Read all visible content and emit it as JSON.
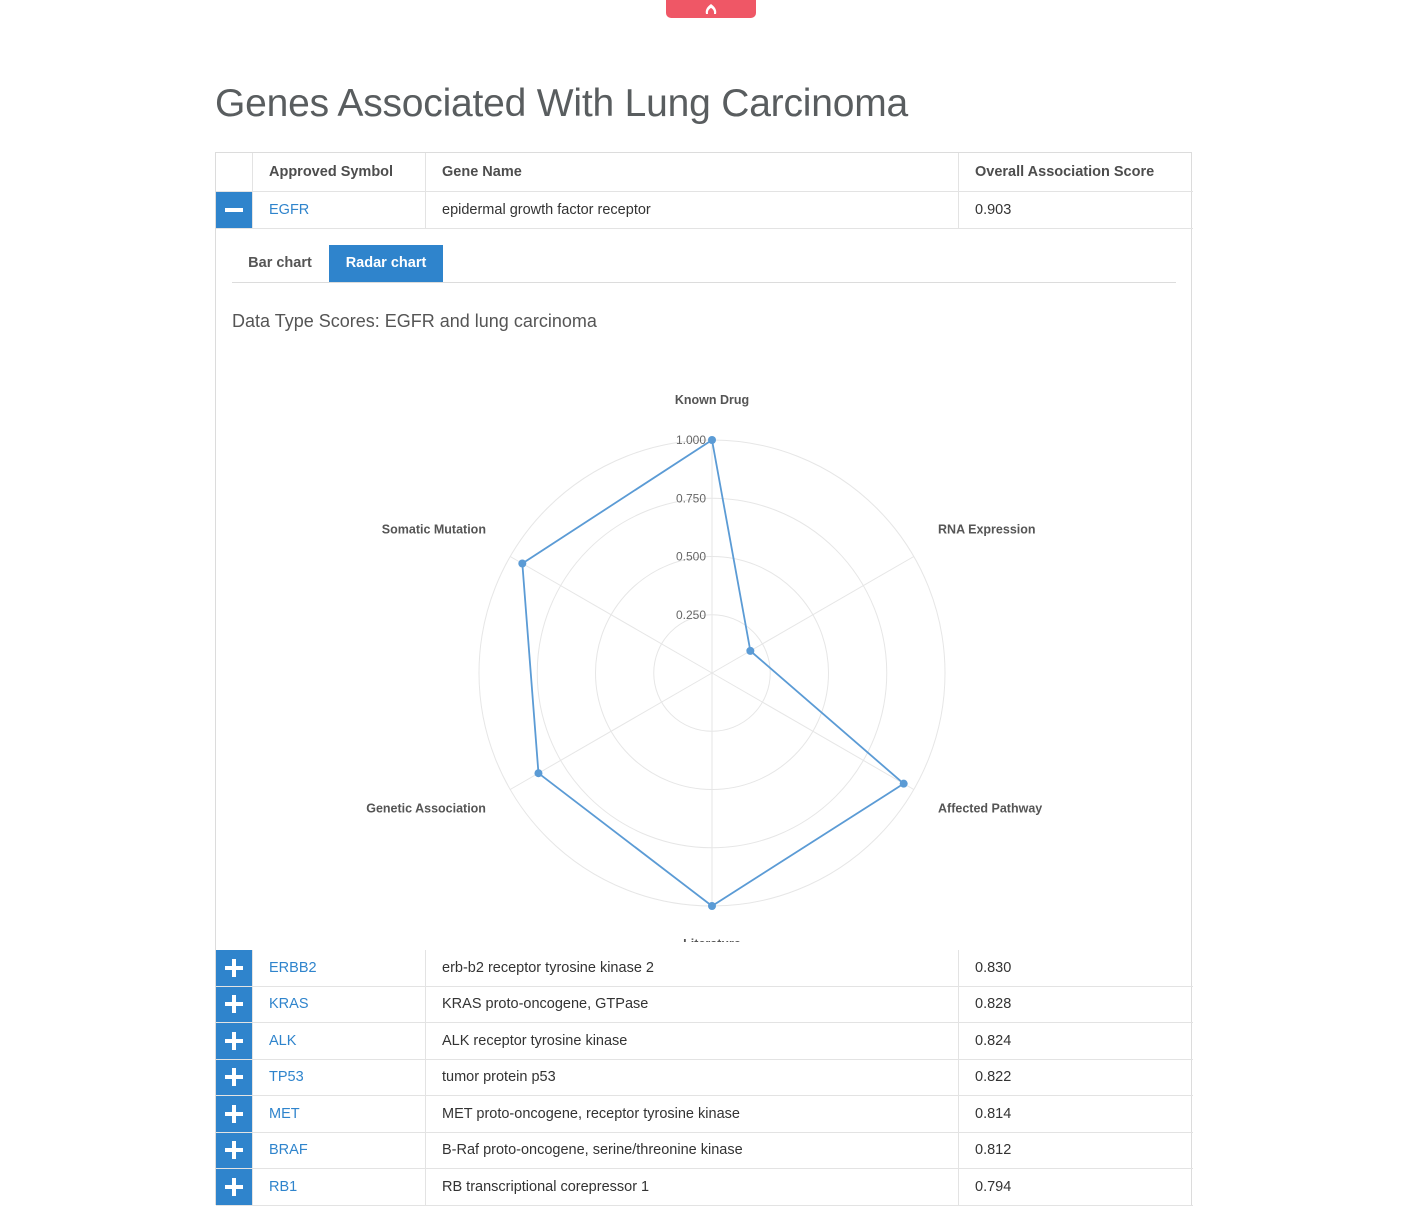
{
  "page": {
    "title": "Genes Associated With Lung Carcinoma"
  },
  "table": {
    "headers": [
      "Approved Symbol",
      "Gene Name",
      "Overall Association Score"
    ],
    "expanded_row": {
      "symbol": "EGFR",
      "name": "epidermal growth factor receptor",
      "score": "0.903"
    },
    "rows": [
      {
        "symbol": "ERBB2",
        "name": "erb-b2 receptor tyrosine kinase 2",
        "score": "0.830"
      },
      {
        "symbol": "KRAS",
        "name": "KRAS proto-oncogene, GTPase",
        "score": "0.828"
      },
      {
        "symbol": "ALK",
        "name": "ALK receptor tyrosine kinase",
        "score": "0.824"
      },
      {
        "symbol": "TP53",
        "name": "tumor protein p53",
        "score": "0.822"
      },
      {
        "symbol": "MET",
        "name": "MET proto-oncogene, receptor tyrosine kinase",
        "score": "0.814"
      },
      {
        "symbol": "BRAF",
        "name": "B-Raf proto-oncogene, serine/threonine kinase",
        "score": "0.812"
      },
      {
        "symbol": "RB1",
        "name": "RB transcriptional corepressor 1",
        "score": "0.794"
      }
    ]
  },
  "detail": {
    "tabs": [
      {
        "label": "Bar chart",
        "active": false
      },
      {
        "label": "Radar chart",
        "active": true
      }
    ]
  },
  "icons": {
    "collapse": "minus-icon",
    "expand": "plus-icon",
    "top_tab": "flame-icon"
  },
  "colors": {
    "accent": "#2f84cc",
    "top_tab": "#ef5766",
    "series": "#5b9bd5"
  },
  "chart_data": {
    "type": "radar",
    "title": "Data Type Scores: EGFR and lung carcinoma",
    "axes": [
      "Known Drug",
      "RNA Expression",
      "Affected Pathway",
      "Literature",
      "Genetic Association",
      "Somatic Mutation"
    ],
    "values": [
      1.0,
      0.19,
      0.95,
      1.0,
      0.86,
      0.94
    ],
    "rlim": [
      0,
      1
    ],
    "ticks": [
      "0.250",
      "0.500",
      "0.750",
      "1.000"
    ],
    "grid": true,
    "legend": "none"
  }
}
